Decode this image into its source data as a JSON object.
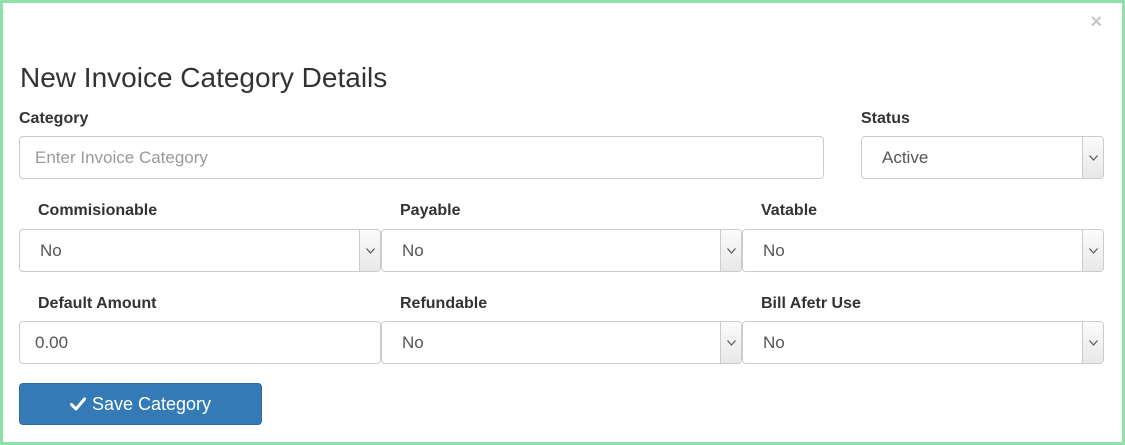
{
  "modal": {
    "close_glyph": "×",
    "title": "New Invoice Category Details"
  },
  "form": {
    "category": {
      "label": "Category",
      "placeholder": "Enter Invoice Category",
      "value": ""
    },
    "status": {
      "label": "Status",
      "value": "Active"
    },
    "commisionable": {
      "label": "Commisionable",
      "value": "No"
    },
    "payable": {
      "label": "Payable",
      "value": "No"
    },
    "vatable": {
      "label": "Vatable",
      "value": "No"
    },
    "default_amount": {
      "label": "Default Amount",
      "value": "0.00"
    },
    "refundable": {
      "label": "Refundable",
      "value": "No"
    },
    "bill_after_use": {
      "label": "Bill Afetr Use",
      "value": "No"
    }
  },
  "actions": {
    "save_label": "Save Category",
    "save_icon": "check-icon"
  },
  "colors": {
    "frame_border": "#90e0a8",
    "primary": "#337ab7"
  }
}
